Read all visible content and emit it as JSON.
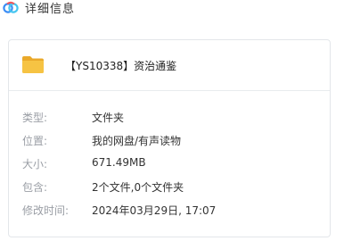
{
  "window": {
    "title": "详细信息"
  },
  "file": {
    "name": "【YS10338】资治通鉴",
    "icon": "folder-icon"
  },
  "details": [
    {
      "key": "type",
      "label": "类型:",
      "value": "文件夹"
    },
    {
      "key": "location",
      "label": "位置:",
      "value": "我的网盘/有声读物"
    },
    {
      "key": "size",
      "label": "大小:",
      "value": "671.49MB"
    },
    {
      "key": "contains",
      "label": "包含:",
      "value": "2个文件,0个文件夹"
    },
    {
      "key": "modified",
      "label": "修改时间:",
      "value": "2024年03月29日, 17:07"
    }
  ],
  "colors": {
    "folder": "#f6c343",
    "folder_tab": "#eaa92a",
    "logo_blue": "#3a8df5",
    "logo_cyan": "#45c6f0",
    "logo_red": "#f2575b"
  }
}
